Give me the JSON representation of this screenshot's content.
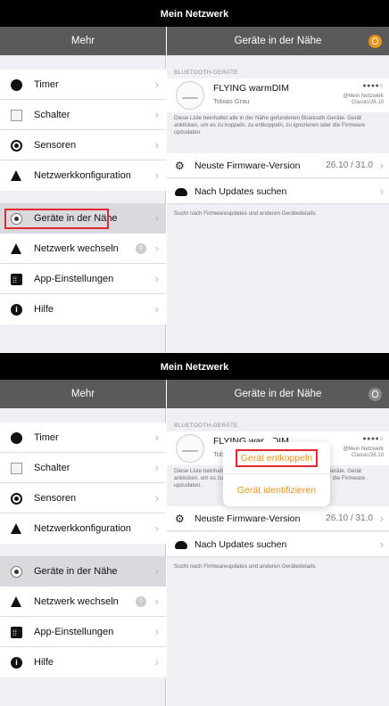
{
  "status_title": "Mein Netzwerk",
  "left_nav_title": "Mehr",
  "right_nav_title": "Geräte in der Nähe",
  "menu_group1": [
    {
      "label": "Timer",
      "icon": "clock-icon"
    },
    {
      "label": "Schalter",
      "icon": "switch-icon"
    },
    {
      "label": "Sensoren",
      "icon": "sensor-icon"
    },
    {
      "label": "Netzwerkkonfiguration",
      "icon": "network-config-icon"
    }
  ],
  "menu_group2": [
    {
      "label": "Geräte in der Nähe",
      "icon": "nearby-devices-icon"
    },
    {
      "label": "Netzwerk wechseln",
      "icon": "network-switch-icon",
      "badge": "0"
    },
    {
      "label": "App-Einstellungen",
      "icon": "app-settings-icon"
    },
    {
      "label": "Hilfe",
      "icon": "help-icon"
    }
  ],
  "bluetooth_header": "BLUETOOTH-GERÄTE",
  "device": {
    "name": "FLYING warmDIM",
    "owner": "Tobias Grau",
    "signal": "●●●●○",
    "network_line1": "@Mein Netzwerk",
    "network_line2": "Classic/26.10"
  },
  "description": "Diese Liste beinhaltet alle in der Nähe gefundenen Bluetooth-Geräte. Gerät anklicken, um es zu koppeln, zu entkoppeln, zu ignorieren oder die Firmware upzudaten.",
  "firmware_label": "Neuste Firmware-Version",
  "firmware_value": "26.10 / 31.0",
  "updates_label": "Nach Updates suchen",
  "footer_text": "Sucht nach Firmwareupdates und anderen Gerätedetails.",
  "popover": {
    "unpair": "Gerät entkoppeln",
    "identify": "Gerät identifizieren"
  },
  "colors": {
    "accent": "#e8931a",
    "highlight": "#e2282f",
    "nav_bg": "#5a5a5a",
    "status_bg": "#000000"
  }
}
